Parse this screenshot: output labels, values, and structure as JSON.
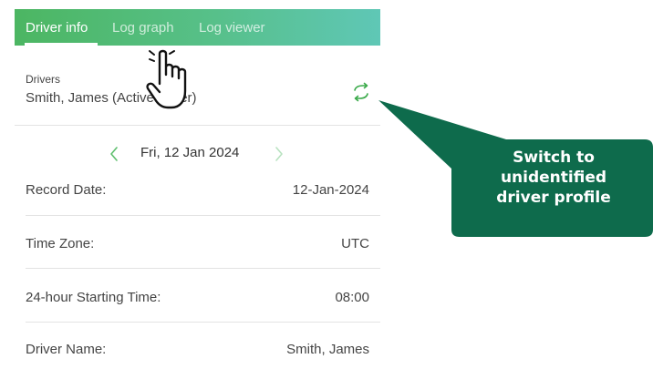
{
  "colors": {
    "header_gradient_start": "#4cb662",
    "header_gradient_end": "#5fc7b6",
    "accent_green": "#3aaa4a",
    "callout_bg": "#0e6b4c",
    "divider": "#e3e3e3"
  },
  "tabs": [
    {
      "label": "Driver info",
      "active": true
    },
    {
      "label": "Log graph",
      "active": false
    },
    {
      "label": "Log viewer",
      "active": false
    }
  ],
  "drivers": {
    "caption": "Drivers",
    "value": "Smith, James (Active driver)",
    "switch_icon": "swap-arrows-icon"
  },
  "date_nav": {
    "date": "Fri, 12 Jan 2024",
    "prev_icon": "chevron-left-icon",
    "next_icon": "chevron-right-icon"
  },
  "rows": [
    {
      "label": "Record Date:",
      "value": "12-Jan-2024"
    },
    {
      "label": "Time Zone:",
      "value": "UTC"
    },
    {
      "label": "24-hour Starting Time:",
      "value": "08:00"
    },
    {
      "label": "Driver Name:",
      "value": "Smith, James"
    }
  ],
  "pointer_icon": "hand-pointer-icon",
  "callout": {
    "lines": [
      "Switch to",
      "unidentified",
      "driver profile"
    ]
  }
}
